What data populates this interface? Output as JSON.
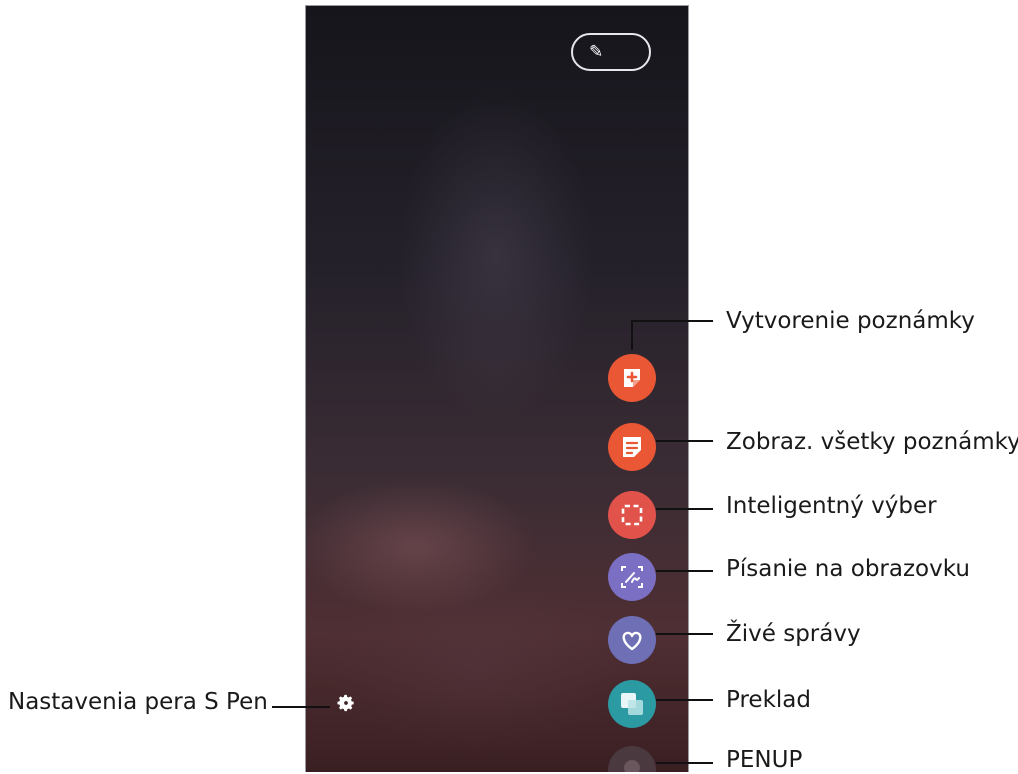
{
  "colors": {
    "create_note": "#e95735",
    "view_all_notes": "#e95735",
    "smart_select": "#e0524a",
    "screen_write": "#7b6fc4",
    "live_messages": "#6e6fb5",
    "translate": "#2c9aa3",
    "penup": "#4a3a40"
  },
  "icons": {
    "pen_settings": "gear-icon",
    "create_note": "note-plus-icon",
    "view_all_notes": "notes-list-icon",
    "smart_select": "dashed-selection-icon",
    "screen_write": "screen-write-icon",
    "live_messages": "heart-icon",
    "translate": "translate-squares-icon",
    "penup": "penup-icon"
  },
  "callouts": {
    "create_note": "Vytvorenie poznámky",
    "view_all_notes": "Zobraz. všetky poznámky",
    "smart_select": "Inteligentný výber",
    "screen_write": "Písanie na obrazovku",
    "live_messages": "Živé správy",
    "translate": "Preklad",
    "penup": "PENUP",
    "pen_settings": "Nastavenia pera S Pen"
  }
}
